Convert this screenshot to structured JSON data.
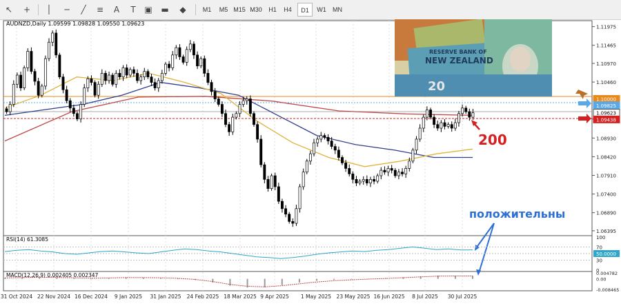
{
  "toolbar": {
    "tools": [
      "cursor-arrow-icon",
      "crosshair-icon",
      "vertical-line-icon",
      "horizontal-line-icon",
      "trend-line-icon",
      "fibonacci-icon",
      "text-label-icon",
      "text-tool-icon",
      "rectangle-icon",
      "shapes-menu-icon"
    ],
    "timeframes": [
      "M1",
      "M5",
      "M15",
      "M30",
      "H1",
      "H4",
      "D1",
      "W1",
      "MN"
    ],
    "active_timeframe": "D1"
  },
  "chart_data": [
    {
      "type": "candlestick",
      "title": "AUDNZD,Daily 1.09599 1.09828 1.09550 1.09623",
      "symbol": "AUDNZD",
      "timeframe": "Daily",
      "ohlc_last": {
        "open": 1.09599,
        "high": 1.09828,
        "low": 1.0955,
        "close": 1.09623
      },
      "x_tick_labels": [
        "31 Oct 2024",
        "22 Nov 2024",
        "16 Dec 2024",
        "9 Jan 2025",
        "31 Jan 2025",
        "24 Feb 2025",
        "18 Mar 2025",
        "9 Apr 2025",
        "1 May 2025",
        "23 May 2025",
        "16 Jun 2025",
        "8 Jul 2025",
        "30 Jul 2025"
      ],
      "y_tick_labels": [
        "1.11975",
        "1.11465",
        "1.10970",
        "1.10460",
        "1.09450",
        "1.08930",
        "1.08420",
        "1.07910",
        "1.07400",
        "1.06890",
        "1.06395"
      ],
      "ylim": [
        1.063,
        1.121
      ],
      "price_labels": [
        {
          "text": "1.10000",
          "value": 1.1,
          "color": "#e8891a"
        },
        {
          "text": "1.09825",
          "value": 1.09825,
          "color": "#5aa9e6"
        },
        {
          "text": "1.09623",
          "value": 1.09623,
          "color": "#ffffff"
        },
        {
          "text": "1.09438",
          "value": 1.09438,
          "color": "#d42020"
        }
      ],
      "series": [
        {
          "name": "price",
          "color": "#000000",
          "values": [
            1.0965,
            1.0985,
            1.104,
            1.1065,
            1.103,
            1.1085,
            1.113,
            1.1075,
            1.1048,
            1.101,
            1.1035,
            1.111,
            1.1155,
            1.118,
            1.112,
            1.106,
            1.1025,
            1.0995,
            1.0975,
            1.096,
            1.0945,
            1.0985,
            1.103,
            1.1055,
            1.1045,
            1.101,
            1.104,
            1.107,
            1.105,
            1.1065,
            1.104,
            1.107,
            1.106,
            1.1085,
            1.1065,
            1.108,
            1.107,
            1.105,
            1.106,
            1.1075,
            1.106,
            1.1045,
            1.103,
            1.105,
            1.107,
            1.1095,
            1.1085,
            1.112,
            1.114,
            1.1115,
            1.11,
            1.1135,
            1.115,
            1.112,
            1.109,
            1.111,
            1.107,
            1.1045,
            1.102,
            1.1,
            1.0985,
            1.096,
            1.093,
            1.091,
            1.095,
            1.096,
            1.0985,
            1.0995,
            1.1,
            1.096,
            1.093,
            1.089,
            1.082,
            1.078,
            1.0755,
            1.079,
            1.076,
            1.072,
            1.07,
            1.0685,
            1.0665,
            1.066,
            1.07,
            1.076,
            1.08,
            1.083,
            1.085,
            1.088,
            1.089,
            1.09,
            1.0895,
            1.0885,
            1.087,
            1.086,
            1.084,
            1.0825,
            1.081,
            1.0795,
            1.078,
            1.077,
            1.0775,
            1.078,
            1.077,
            1.078,
            1.0775,
            1.079,
            1.0805,
            1.08,
            1.081,
            1.0805,
            1.079,
            1.08,
            1.0795,
            1.081,
            1.083,
            1.086,
            1.089,
            1.092,
            1.095,
            1.097,
            1.095,
            1.093,
            1.092,
            1.0935,
            1.0925,
            1.093,
            1.092,
            1.0935,
            1.096,
            1.0975,
            1.0965,
            1.095,
            1.0962
          ]
        },
        {
          "name": "sma-200",
          "color": "#c04848",
          "values": [
            1.0885,
            1.0965,
            1.1005,
            1.1007,
            1.0994,
            1.0967,
            1.0959,
            1.0955
          ]
        },
        {
          "name": "ma-100",
          "color": "#2e3d8e",
          "values": [
            1.0955,
            1.097,
            1.0985,
            1.101,
            1.1045,
            1.103,
            1.101,
            1.0955,
            1.09,
            1.0875,
            1.086,
            1.084,
            1.084
          ]
        },
        {
          "name": "ma-50",
          "color": "#e0b23a",
          "values": [
            1.0975,
            1.101,
            1.106,
            1.105,
            1.107,
            1.1045,
            1.1015,
            1.094,
            1.088,
            1.084,
            1.0815,
            1.083,
            1.085,
            1.0863
          ]
        }
      ],
      "annotations": [
        {
          "text": "200",
          "color": "#d42020"
        },
        {
          "text": "положительны",
          "color": "#2e6fd4"
        }
      ]
    },
    {
      "type": "line",
      "title": "RSI(14) 61.3085",
      "ylim": [
        0,
        100
      ],
      "y_tick_labels": [
        "100",
        "70",
        "50.0000",
        "30",
        "0"
      ],
      "levels": [
        70,
        50,
        30
      ],
      "series": [
        {
          "name": "RSI",
          "color": "#2fa6c9",
          "values": [
            56,
            60,
            62,
            58,
            55,
            50,
            48,
            52,
            56,
            58,
            55,
            52,
            50,
            55,
            60,
            64,
            62,
            58,
            55,
            50,
            45,
            40,
            38,
            35,
            38,
            42,
            48,
            52,
            55,
            58,
            56,
            60,
            62,
            66,
            70,
            66,
            62,
            64,
            61,
            61.3085
          ]
        }
      ]
    },
    {
      "type": "bar",
      "title": "MACD(12,26,9) 0.002405 0.002347",
      "ylim": [
        -0.008465,
        0.004782
      ],
      "y_tick_labels": [
        "0.004782",
        "0.00",
        "-0.008465"
      ],
      "series": [
        {
          "name": "MACD",
          "color": "#888888",
          "values": [
            0.0008,
            0.0012,
            0.0015,
            0.001,
            0.0006,
            0.0004,
            0.0008,
            0.0012,
            0.001,
            0.0006,
            0.0002,
            -0.001,
            -0.003,
            -0.0055,
            -0.007,
            -0.0068,
            -0.005,
            -0.003,
            -0.0015,
            -0.0008,
            -0.0004,
            0.0001,
            0.0006,
            0.0012,
            0.002,
            0.0026,
            0.0024,
            0.0024
          ]
        },
        {
          "name": "Signal",
          "color": "#c04848",
          "values": [
            0.0007,
            0.001,
            0.0013,
            0.0011,
            0.0008,
            0.0005,
            0.0007,
            0.001,
            0.001,
            0.0008,
            0.0004,
            -0.0005,
            -0.0022,
            -0.0045,
            -0.006,
            -0.0064,
            -0.0055,
            -0.004,
            -0.0025,
            -0.0015,
            -0.0008,
            -0.0002,
            0.0003,
            0.0009,
            0.0016,
            0.0022,
            0.0023,
            0.0023
          ]
        }
      ]
    }
  ]
}
